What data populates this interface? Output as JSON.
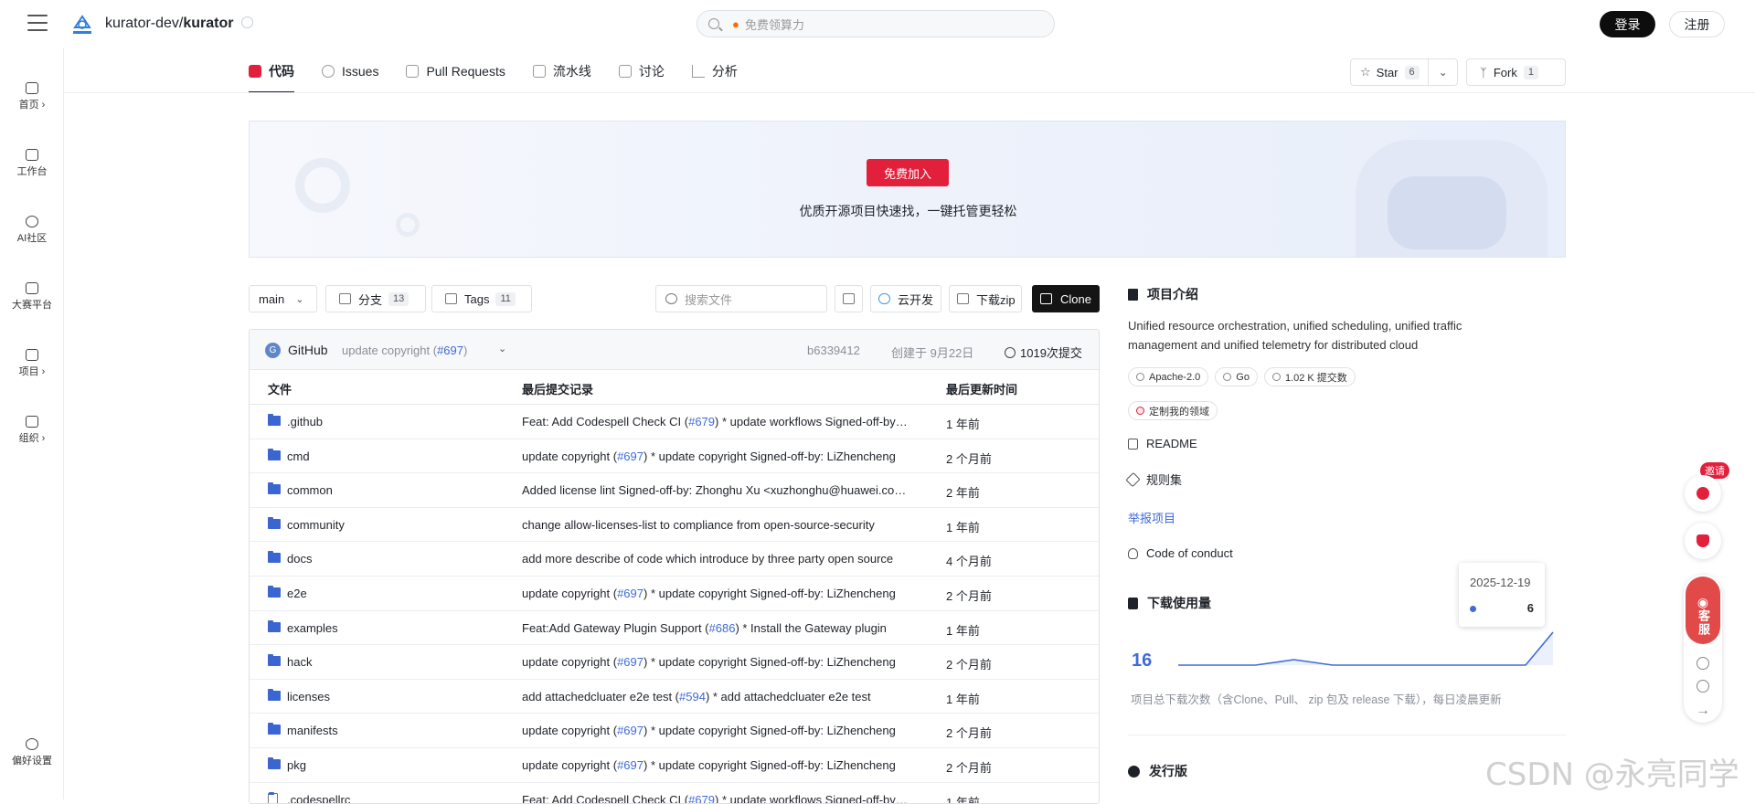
{
  "header": {
    "org": "kurator-dev/",
    "repo": "kurator",
    "search_placeholder": "免费领算力",
    "login": "登录",
    "register": "注册"
  },
  "rail": {
    "items": [
      {
        "label": "首页 ›",
        "icon": "home-icon"
      },
      {
        "label": "工作台",
        "icon": "dashboard-icon"
      },
      {
        "label": "AI社区",
        "icon": "ai-icon"
      },
      {
        "label": "大赛平台",
        "icon": "trophy-icon"
      },
      {
        "label": "项目 ›",
        "icon": "folder-icon"
      },
      {
        "label": "组织 ›",
        "icon": "building-icon"
      }
    ],
    "settings": "偏好设置"
  },
  "tabs": [
    {
      "label": "代码",
      "icon": "code-icon",
      "color": "#e2203c"
    },
    {
      "label": "Issues",
      "icon": "issue-icon",
      "color": "#999999"
    },
    {
      "label": "Pull Requests",
      "icon": "pull-request-icon",
      "color": "#999999"
    },
    {
      "label": "流水线",
      "icon": "pipeline-icon",
      "color": "#999999"
    },
    {
      "label": "讨论",
      "icon": "discussion-icon",
      "color": "#999999"
    },
    {
      "label": "分析",
      "icon": "analytics-icon",
      "color": "#999999"
    }
  ],
  "actions": {
    "star_label": "Star",
    "star_count": "6",
    "fork_label": "Fork",
    "fork_count": "1"
  },
  "banner": {
    "join": "免费加入",
    "text": "优质开源项目快速找，一键托管更轻松"
  },
  "toolbar": {
    "branch": "main",
    "branches_label": "分支",
    "branches_count": "13",
    "tags_label": "Tags",
    "tags_count": "11",
    "search_placeholder": "搜索文件",
    "cloud_dev": "云开发",
    "download_zip": "下载zip",
    "clone": "Clone"
  },
  "commit": {
    "avatar": "G",
    "author": "GitHub",
    "message": "update copyright (",
    "pr": "#697",
    "message_end": ")",
    "sha": "b6339412",
    "date": "创建于 9月22日",
    "total": "1019次提交"
  },
  "table": {
    "headers": [
      "文件",
      "最后提交记录",
      "最后更新时间"
    ],
    "rows": [
      {
        "name": ".github",
        "pre": "Feat: Add Codespell Check CI (",
        "pr": "#679",
        "post": ") * update workflows Signed-off-by: ...",
        "time": "1 年前"
      },
      {
        "name": "cmd",
        "pre": "update copyright (",
        "pr": "#697",
        "post": ") * update copyright Signed-off-by: LiZhencheng",
        "time": "2 个月前"
      },
      {
        "name": "common",
        "pre": "Added license lint Signed-off-by: Zhonghu Xu <xuzhonghu@huawei.com>",
        "pr": "",
        "post": "",
        "time": "2 年前"
      },
      {
        "name": "community",
        "pre": "change allow-licenses-list to compliance from open-source-security",
        "pr": "",
        "post": "",
        "time": "1 年前"
      },
      {
        "name": "docs",
        "pre": "add more describe of code which introduce by three party open source",
        "pr": "",
        "post": "",
        "time": "4 个月前"
      },
      {
        "name": "e2e",
        "pre": "update copyright (",
        "pr": "#697",
        "post": ") * update copyright Signed-off-by: LiZhencheng",
        "time": "2 个月前"
      },
      {
        "name": "examples",
        "pre": "Feat:Add Gateway Plugin Support (",
        "pr": "#686",
        "post": ") * Install the Gateway plugin",
        "time": "1 年前"
      },
      {
        "name": "hack",
        "pre": "update copyright (",
        "pr": "#697",
        "post": ") * update copyright Signed-off-by: LiZhencheng",
        "time": "2 个月前"
      },
      {
        "name": "licenses",
        "pre": "add attachedcluater e2e test (",
        "pr": "#594",
        "post": ") * add attachedcluater e2e test",
        "time": "1 年前"
      },
      {
        "name": "manifests",
        "pre": "update copyright (",
        "pr": "#697",
        "post": ") * update copyright Signed-off-by: LiZhencheng",
        "time": "2 个月前"
      },
      {
        "name": "pkg",
        "pre": "update copyright (",
        "pr": "#697",
        "post": ") * update copyright Signed-off-by: LiZhencheng",
        "time": "2 个月前"
      },
      {
        "name": ".codespellrc",
        "pre": "Feat: Add Codespell Check CI (",
        "pr": "#679",
        "post": ") * update workflows Signed-off-by: ...",
        "time": "1 年前"
      }
    ]
  },
  "sidebar": {
    "about_title": "项目介绍",
    "description": "Unified resource orchestration, unified scheduling, unified traffic management and unified telemetry for distributed cloud",
    "tags": [
      "Apache-2.0",
      "Go",
      "1.02 K 提交数"
    ],
    "custom_domain": "定制我的领域",
    "readme": "README",
    "rules": "规则集",
    "report": "举报项目",
    "conduct": "Code of conduct",
    "downloads_title": "下载使用量",
    "downloads_total": "16",
    "downloads_note": "项目总下载次数（含Clone、Pull、 zip 包及 release 下载），每日凌晨更新",
    "release_title": "发行版"
  },
  "tooltip": {
    "date": "2025-12-19",
    "value": "6"
  },
  "chart_data": {
    "type": "line",
    "x": [
      "",
      "",
      "",
      "",
      "",
      "",
      "",
      "",
      "",
      "",
      "2025-12-19"
    ],
    "values": [
      0,
      0,
      0,
      1,
      0,
      0,
      0,
      0,
      0,
      0,
      6
    ],
    "color": "#3f6ad8"
  },
  "floating": {
    "invite": "邀请",
    "service": "客服"
  },
  "watermark": "CSDN @永亮同学"
}
